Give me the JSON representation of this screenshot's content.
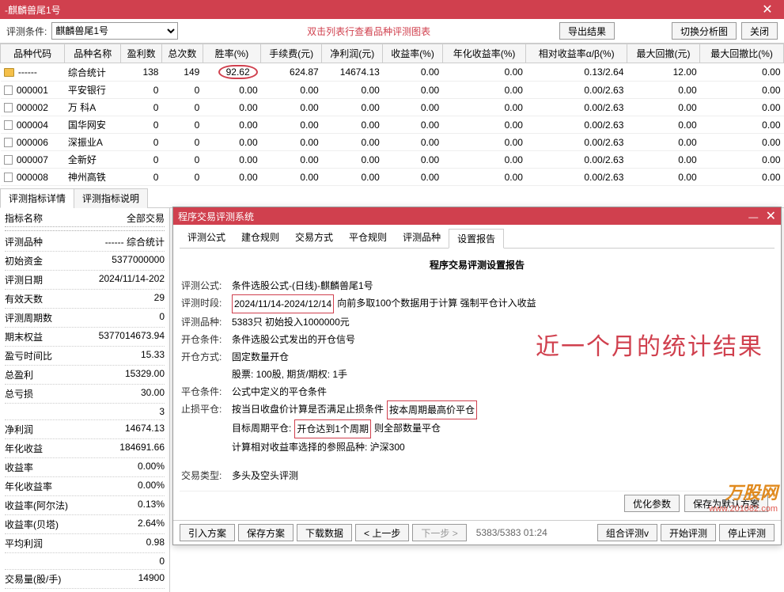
{
  "window": {
    "title": "-麒麟兽尾1号",
    "close": "✕"
  },
  "toolbar": {
    "label": "评测条件:",
    "select_value": "麒麟兽尾1号",
    "hint": "双击列表行查看品种评测图表",
    "export": "导出结果",
    "switch": "切换分析图",
    "close": "关闭"
  },
  "columns": [
    "品种代码",
    "品种名称",
    "盈利数",
    "总次数",
    "胜率(%)",
    "手续费(元)",
    "净利润(元)",
    "收益率(%)",
    "年化收益率(%)",
    "相对收益率α/β(%)",
    "最大回撤(元)",
    "最大回撤比(%)"
  ],
  "rows": [
    {
      "code": "------",
      "name": "综合统计",
      "win": "138",
      "total": "149",
      "rate": "92.62",
      "fee": "624.87",
      "profit": "14674.13",
      "ret": "0.00",
      "annual": "0.00",
      "rel": "0.13/2.64",
      "dd": "12.00",
      "ddp": "0.00",
      "folder": true
    },
    {
      "code": "000001",
      "name": "平安银行",
      "win": "0",
      "total": "0",
      "rate": "0.00",
      "fee": "0.00",
      "profit": "0.00",
      "ret": "0.00",
      "annual": "0.00",
      "rel": "0.00/2.63",
      "dd": "0.00",
      "ddp": "0.00"
    },
    {
      "code": "000002",
      "name": "万 科A",
      "win": "0",
      "total": "0",
      "rate": "0.00",
      "fee": "0.00",
      "profit": "0.00",
      "ret": "0.00",
      "annual": "0.00",
      "rel": "0.00/2.63",
      "dd": "0.00",
      "ddp": "0.00"
    },
    {
      "code": "000004",
      "name": "国华网安",
      "win": "0",
      "total": "0",
      "rate": "0.00",
      "fee": "0.00",
      "profit": "0.00",
      "ret": "0.00",
      "annual": "0.00",
      "rel": "0.00/2.63",
      "dd": "0.00",
      "ddp": "0.00"
    },
    {
      "code": "000006",
      "name": "深振业A",
      "win": "0",
      "total": "0",
      "rate": "0.00",
      "fee": "0.00",
      "profit": "0.00",
      "ret": "0.00",
      "annual": "0.00",
      "rel": "0.00/2.63",
      "dd": "0.00",
      "ddp": "0.00"
    },
    {
      "code": "000007",
      "name": "全新好",
      "win": "0",
      "total": "0",
      "rate": "0.00",
      "fee": "0.00",
      "profit": "0.00",
      "ret": "0.00",
      "annual": "0.00",
      "rel": "0.00/2.63",
      "dd": "0.00",
      "ddp": "0.00"
    },
    {
      "code": "000008",
      "name": "神州高铁",
      "win": "0",
      "total": "0",
      "rate": "0.00",
      "fee": "0.00",
      "profit": "0.00",
      "ret": "0.00",
      "annual": "0.00",
      "rel": "0.00/2.63",
      "dd": "0.00",
      "ddp": "0.00"
    }
  ],
  "tabs": {
    "detail": "评测指标详情",
    "desc": "评测指标说明"
  },
  "left": {
    "h1": "指标名称",
    "h2": "全部交易",
    "items": [
      {
        "k": "评测品种",
        "v": "------ 综合统计"
      },
      {
        "k": "初始资金",
        "v": "5377000000"
      },
      {
        "k": "评测日期",
        "v": "2024/11/14-202"
      },
      {
        "k": "有效天数",
        "v": "29"
      },
      {
        "k": "评测周期数",
        "v": "0"
      },
      {
        "k": "期末权益",
        "v": "5377014673.94"
      },
      {
        "k": "盈亏时间比",
        "v": "15.33"
      },
      {
        "k": "总盈利",
        "v": "15329.00"
      },
      {
        "k": "总亏损",
        "v": "30.00"
      },
      {
        "k": "净利润",
        "v": "14674.13"
      },
      {
        "k": "年化收益",
        "v": "184691.66"
      },
      {
        "k": "收益率",
        "v": "0.00%"
      },
      {
        "k": "年化收益率",
        "v": "0.00%"
      },
      {
        "k": "收益率(阿尔法)",
        "v": "0.13%"
      },
      {
        "k": "收益率(贝塔)",
        "v": "2.64%"
      },
      {
        "k": "平均利润",
        "v": "0.98"
      },
      {
        "k": "交易量(股/手)",
        "v": "14900"
      }
    ],
    "extra": [
      "3",
      "0"
    ]
  },
  "sub": {
    "title": "程序交易评测系统",
    "tabs": [
      "评测公式",
      "建仓规则",
      "交易方式",
      "平仓规则",
      "评测品种",
      "设置报告"
    ],
    "active_tab": 5,
    "report_title": "程序交易评测设置报告",
    "lines": {
      "l1k": "评测公式:",
      "l1v": "条件选股公式-(日线)-麒麟兽尾1号",
      "l2k": "评测时段:",
      "l2v1": "2024/11/14-2024/12/14",
      "l2v2": "向前多取100个数据用于计算 强制平仓计入收益",
      "l3k": "评测品种:",
      "l3v": "5383只 初始投入1000000元",
      "l4k": "开仓条件:",
      "l4v": "条件选股公式发出的开仓信号",
      "l5k": "开仓方式:",
      "l5v": "固定数量开仓",
      "l6": "股票: 100股, 期货/期权: 1手",
      "l7k": "平仓条件:",
      "l7v": "公式中定义的平仓条件",
      "l8k": "止损平仓:",
      "l8v1": "按当日收盘价计算是否满足止损条件",
      "l8v2": "按本周期最高价平仓",
      "l9a": "目标周期平仓:",
      "l9b": "开仓达到1个周期",
      "l9c": "则全部数量平仓",
      "l10": "计算相对收益率选择的参照品种: 沪深300",
      "l11k": "交易类型:",
      "l11v": "多头及空头评测"
    },
    "bigred": "近一个月的统计结果",
    "btn_opt": "优化参数",
    "btn_save": "保存为默认方案",
    "bb": {
      "import": "引入方案",
      "save": "保存方案",
      "download": "下载数据",
      "prev": "< 上一步",
      "next": "下一步 >",
      "status": "5383/5383 01:24",
      "combo": "组合评测v",
      "start": "开始评测",
      "stop": "停止评测"
    }
  },
  "wm": {
    "t1": "万股网",
    "t2": "www.201082.com"
  }
}
